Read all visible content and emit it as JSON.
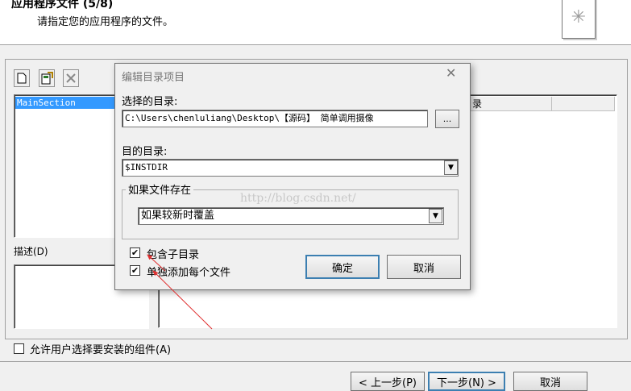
{
  "header": {
    "title": "应用程序文件 (5/8)",
    "subtitle": "请指定您的应用程序的文件。"
  },
  "toolbar": {
    "new_icon": "new-file-icon",
    "add_icon": "add-files-icon",
    "delete_icon": "delete-icon"
  },
  "tree": {
    "selected_item": "MainSection"
  },
  "list": {
    "column_partial": "录"
  },
  "description_label": "描述(D)",
  "allow_user_select_label": "允许用户选择要安装的组件(A)",
  "footer": {
    "back_label": "< 上一步(P)",
    "next_label": "下一步(N) >",
    "cancel_label": "取消"
  },
  "dialog": {
    "title": "编辑目录项目",
    "close_glyph": "✕",
    "source_label": "选择的目录:",
    "source_value": "C:\\Users\\chenluliang\\Desktop\\【源码】 简单调用摄像",
    "browse_label": "...",
    "dest_label": "目的目录:",
    "dest_value": "$INSTDIR",
    "if_exists_label": "如果文件存在",
    "if_exists_value": "如果较新时覆盖",
    "include_subdirs_label": "包含子目录",
    "add_each_file_label": "单独添加每个文件",
    "ok_label": "确定",
    "cancel_label": "取消",
    "watermark": "http://blog.csdn.net/"
  },
  "colors": {
    "selection": "#3399ff",
    "annotation_arrow": "#e03030"
  }
}
